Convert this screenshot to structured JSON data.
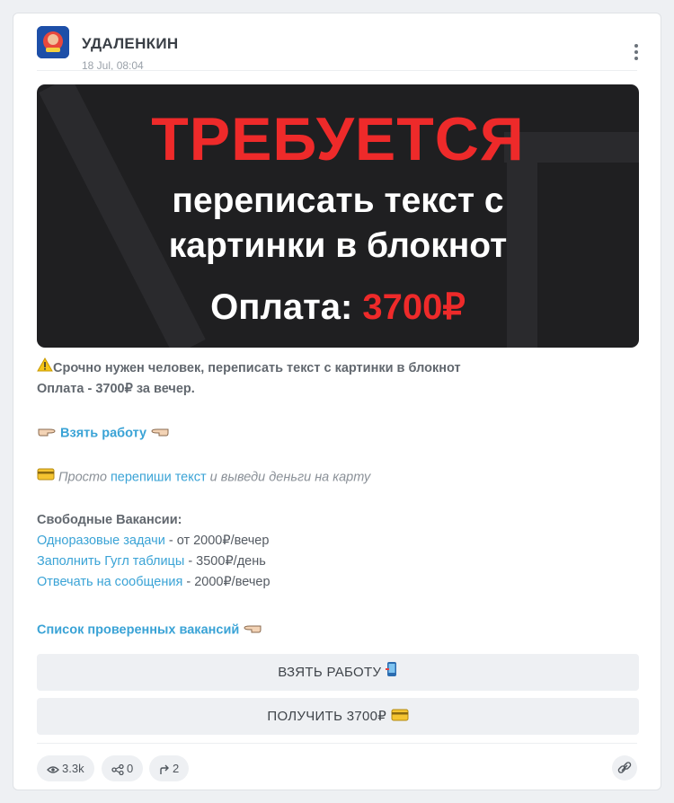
{
  "post": {
    "channel_name": "УДАЛЕНКИН",
    "time": "18 Jul, 08:04"
  },
  "banner": {
    "title": "ТРЕБУЕТСЯ",
    "line1": "переписать текст с",
    "line2": "картинки в блокнот",
    "pay_label": "Оплата:",
    "pay_amount": "3700₽"
  },
  "text": {
    "warning": "Срочно нужен человек, переписать текст с картинки в блокнот",
    "payment": "Оплата - 3700₽ за вечер.",
    "take_job_link": "Взять работу",
    "card_prefix": "Просто",
    "card_link": "перепиши текст",
    "card_suffix": "и выведи деньги на карту",
    "vacancies_heading": "Свободные Вакансии:",
    "vacancies": [
      {
        "link": "Одноразовые задачи",
        "rest": " - от 2000₽/вечер"
      },
      {
        "link": "Заполнить Гугл таблицы",
        "rest": " - 3500₽/день"
      },
      {
        "link": "Отвечать на сообщения",
        "rest": " - 2000₽/вечер"
      }
    ],
    "verified_link": "Список проверенных вакансий"
  },
  "buttons": {
    "take_job": "ВЗЯТЬ РАБОТУ",
    "get_money": "ПОЛУЧИТЬ 3700₽"
  },
  "stats": {
    "views": "3.3k",
    "reactions": "0",
    "forwards": "2"
  },
  "colors": {
    "accent_link": "#3aa3d6",
    "banner_red": "#ee2a2a",
    "banner_bg": "#1f1f21"
  }
}
